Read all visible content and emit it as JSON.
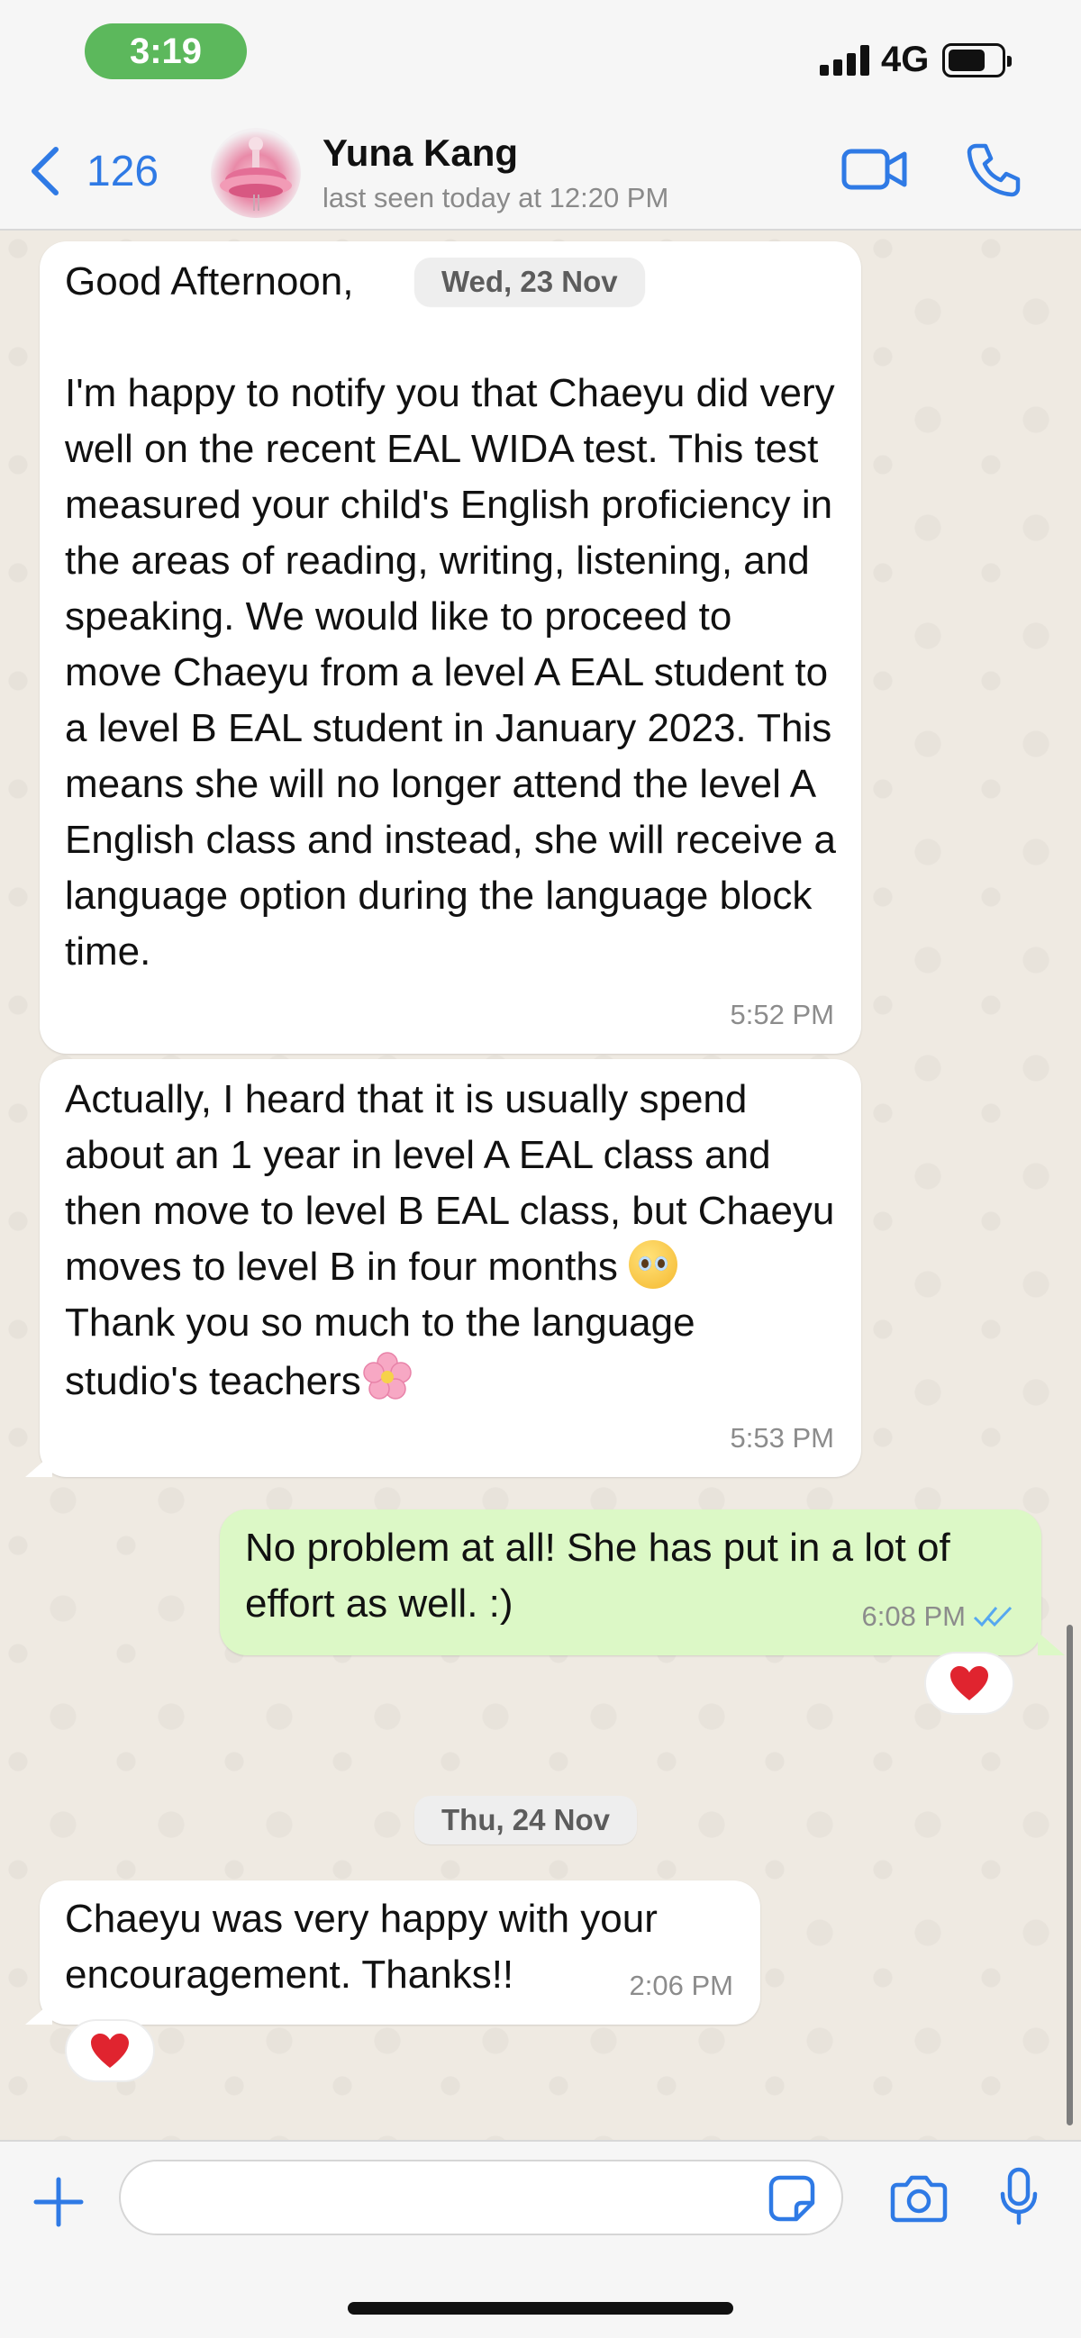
{
  "status_bar": {
    "time": "3:19",
    "network": "4G",
    "battery_level": 0.72
  },
  "header": {
    "back_count": "126",
    "contact_name": "Yuna Kang",
    "last_seen": "last seen today at 12:20 PM",
    "icons": [
      "chevron-left-icon",
      "video-icon",
      "phone-icon"
    ]
  },
  "messages": [
    {
      "direction": "incoming",
      "text": "Good Afternoon,\n\nI'm happy to notify you that Chaeyu did very well on the recent EAL WIDA test. This test measured your child's English proficiency in the areas of reading, writing, listening, and speaking. We would like to proceed to move Chaeyu from a level A EAL student to a level B EAL student in January 2023. This means she will no longer attend the level A English class and instead, she will receive a language option during the language block time.",
      "time": "5:52 PM"
    },
    {
      "direction": "incoming",
      "text_part1": "Actually, I heard that it is usually spend about an 1 year in level A EAL class and then move to level B EAL class, but Chaeyu moves to level B in four months",
      "emoji1": "pleading-face-emoji",
      "text_part2": "Thank you so much to the language studio's teachers",
      "emoji2": "cherry-blossom-emoji",
      "time": "5:53 PM"
    },
    {
      "direction": "outgoing",
      "text": "No problem at all! She has put in a lot of effort as well. :)",
      "time": "6:08 PM",
      "status": "read",
      "reaction": "red-heart"
    },
    {
      "direction": "incoming",
      "text": "Chaeyu was very happy with your encouragement. Thanks!!",
      "time": "2:06 PM",
      "reaction": "red-heart"
    }
  ],
  "date_chips": {
    "first": "Wed, 23 Nov",
    "second": "Thu, 24 Nov"
  },
  "composer": {
    "placeholder": "",
    "icons": [
      "plus-icon",
      "sticker-icon",
      "camera-icon",
      "microphone-icon"
    ]
  },
  "colors": {
    "accent": "#2f7ae5",
    "outgoing_bubble": "#dcf8c6",
    "incoming_bubble": "#ffffff",
    "chat_background": "#efeae2",
    "time_pill": "#5cb85c",
    "heart": "#e0242f"
  }
}
